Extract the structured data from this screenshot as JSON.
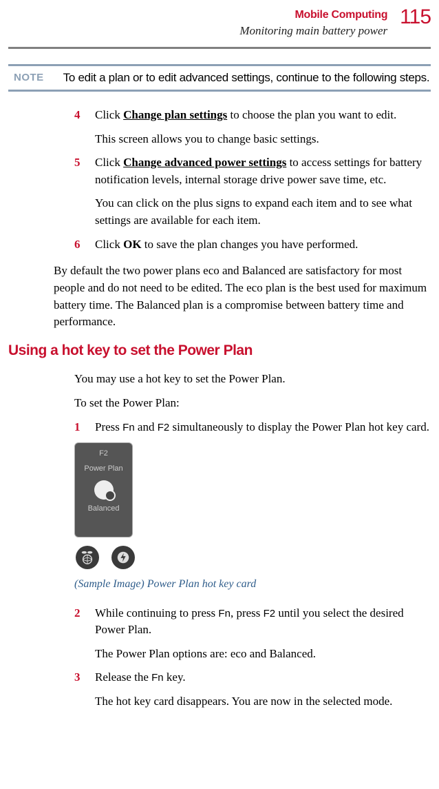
{
  "header": {
    "chapter": "Mobile Computing",
    "section": "Monitoring main battery power",
    "page": "115"
  },
  "note": {
    "label": "NOTE",
    "text": "To edit a plan or to edit advanced settings, continue to the following steps."
  },
  "steps_a": [
    {
      "n": "4",
      "paras": [
        {
          "pre": "Click ",
          "bu": "Change plan settings",
          "post": " to choose the plan you want to edit."
        },
        {
          "text": "This screen allows you to change basic settings."
        }
      ]
    },
    {
      "n": "5",
      "paras": [
        {
          "pre": "Click ",
          "bu": "Change advanced power settings",
          "post": " to access settings for battery notification levels, internal storage drive power save time, etc."
        },
        {
          "text": "You can click on the plus signs to expand each item and to see what settings are available for each item."
        }
      ]
    },
    {
      "n": "6",
      "paras": [
        {
          "pre": "Click ",
          "b": "OK",
          "post": " to save the plan changes you have performed."
        }
      ]
    }
  ],
  "para1": "By default the two power plans eco and Balanced are satisfactory for most people and do not need to be edited. The eco plan is the best used for maximum battery time. The Balanced plan is a compromise between battery time and performance.",
  "h2": "Using a hot key to set the Power Plan",
  "intro1": "You may use a hot key to set the Power Plan.",
  "intro2": "To set the Power Plan:",
  "steps_b": {
    "s1": {
      "n": "1",
      "pre": "Press ",
      "k1": "Fn",
      "mid": " and ",
      "k2": "F2",
      "post": " simultaneously to display the Power Plan hot key card."
    },
    "s2": {
      "n": "2",
      "pre": "While continuing to press ",
      "k1": "Fn",
      "mid": ", press ",
      "k2": "F2",
      "post": " until you select the desired Power Plan.",
      "extra": "The Power Plan options are: eco and Balanced."
    },
    "s3": {
      "n": "3",
      "pre": "Release the ",
      "k1": "Fn",
      "post": " key.",
      "extra": "The hot key card disappears. You are now in the selected mode."
    }
  },
  "card": {
    "key": "F2",
    "title": "Power Plan",
    "mode": "Balanced"
  },
  "caption": "(Sample Image) Power Plan hot key card"
}
